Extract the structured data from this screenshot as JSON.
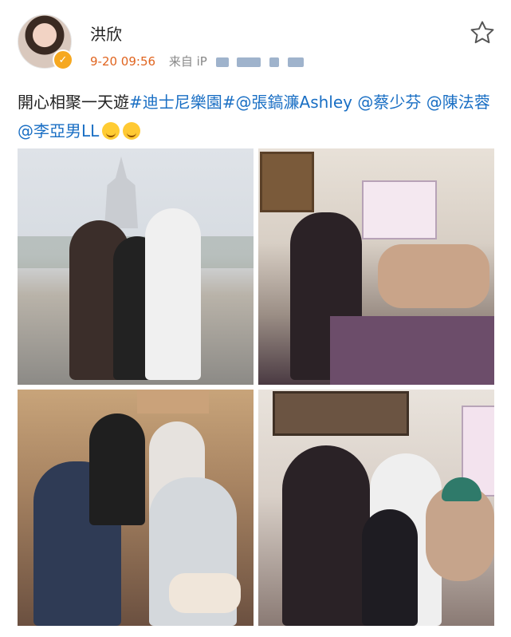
{
  "post": {
    "username": "洪欣",
    "timestamp": "9-20 09:56",
    "source_prefix": "来自 iP",
    "text_lead": "開心相聚一天遊",
    "hashtag": "#迪士尼樂園#",
    "mentions": [
      "@張鎬濂Ashley",
      "@蔡少芬",
      "@陳法蓉",
      "@李亞男LL"
    ]
  },
  "icons": {
    "favorite": "star-outline-icon",
    "verified": "verified-badge-icon",
    "emoji_1": "smile-emoji",
    "emoji_2": "surprised-emoji"
  },
  "colors": {
    "username": "#222222",
    "timestamp": "#e0641f",
    "link": "#1a6fc4",
    "badge": "#f6a820"
  },
  "photos": [
    {
      "name": "photo-castle-family"
    },
    {
      "name": "photo-cafe-duffy"
    },
    {
      "name": "photo-group-friends"
    },
    {
      "name": "photo-kids-duffy"
    }
  ]
}
